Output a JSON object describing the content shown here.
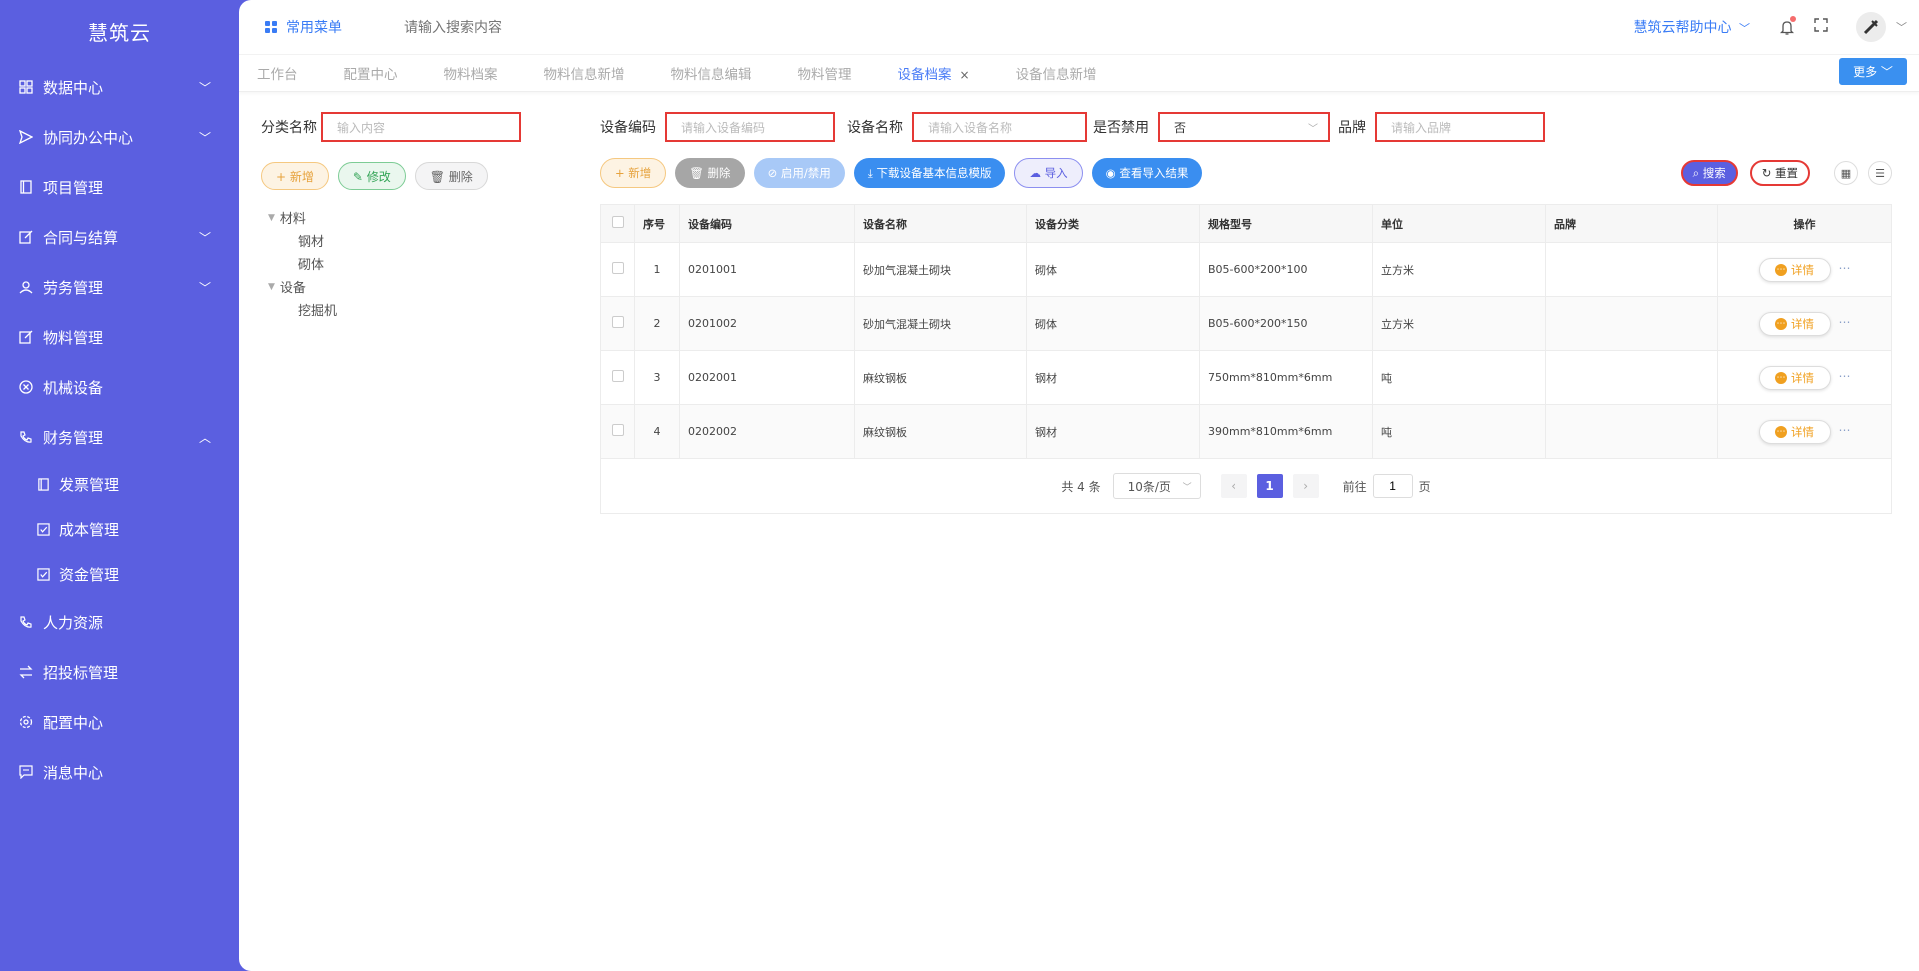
{
  "app_title": "慧筑云",
  "sidebar": {
    "items": [
      {
        "label": "数据中心",
        "icon": "grid-icon",
        "chevron": "﹀"
      },
      {
        "label": "协同办公中心",
        "icon": "send-icon",
        "chevron": "﹀"
      },
      {
        "label": "项目管理",
        "icon": "book-icon",
        "chevron": ""
      },
      {
        "label": "合同与结算",
        "icon": "edit-icon",
        "chevron": "﹀"
      },
      {
        "label": "劳务管理",
        "icon": "user-icon",
        "chevron": "﹀"
      },
      {
        "label": "物料管理",
        "icon": "edit-icon",
        "chevron": ""
      },
      {
        "label": "机械设备",
        "icon": "circle-x-icon",
        "chevron": ""
      },
      {
        "label": "财务管理",
        "icon": "phone-icon",
        "chevron": "︿"
      }
    ],
    "sub_items": [
      {
        "label": "发票管理",
        "icon": "book-icon"
      },
      {
        "label": "成本管理",
        "icon": "checkbox-icon"
      },
      {
        "label": "资金管理",
        "icon": "checkbox-icon"
      }
    ],
    "items_after": [
      {
        "label": "人力资源",
        "icon": "phone-icon"
      },
      {
        "label": "招投标管理",
        "icon": "transfer-icon"
      },
      {
        "label": "配置中心",
        "icon": "gear-icon"
      },
      {
        "label": "消息中心",
        "icon": "message-icon"
      }
    ]
  },
  "topbar": {
    "favorites_label": "常用菜单",
    "search_placeholder": "请输入搜索内容",
    "help_label": "慧筑云帮助中心",
    "help_chevron": "﹀"
  },
  "tabs": [
    {
      "label": "工作台"
    },
    {
      "label": "配置中心"
    },
    {
      "label": "物料档案"
    },
    {
      "label": "物料信息新增"
    },
    {
      "label": "物料信息编辑"
    },
    {
      "label": "物料管理"
    },
    {
      "label": "设备档案",
      "active": true
    },
    {
      "label": "设备信息新增"
    }
  ],
  "more_label": "更多 ﹀",
  "left_panel": {
    "category_label": "分类名称",
    "category_placeholder": "输入内容",
    "buttons": {
      "add": "+ 新增",
      "edit": "✎ 修改",
      "delete": "🗑 删除"
    },
    "tree": [
      {
        "label": "材料",
        "children": [
          "钢材",
          "砌体"
        ]
      },
      {
        "label": "设备",
        "children": [
          "挖掘机"
        ]
      }
    ]
  },
  "filters": {
    "code_label": "设备编码",
    "code_placeholder": "请输入设备编码",
    "name_label": "设备名称",
    "name_placeholder": "请输入设备名称",
    "disabled_label": "是否禁用",
    "disabled_value": "否",
    "brand_label": "品牌",
    "brand_placeholder": "请输入品牌"
  },
  "actions": {
    "add": "+ 新增",
    "delete": "🗑 删除",
    "toggle": "⊘ 启用/禁用",
    "download": "⤓ 下载设备基本信息模版",
    "import": "☁ 导入",
    "view_import": "◉ 查看导入结果",
    "search": "⌕ 搜索",
    "reset": "↻ 重置"
  },
  "table": {
    "headers": [
      "序号",
      "设备编码",
      "设备名称",
      "设备分类",
      "规格型号",
      "单位",
      "品牌",
      "操作"
    ],
    "rows": [
      {
        "index": "1",
        "code": "0201001",
        "name": "砂加气混凝土砌块",
        "category": "砌体",
        "spec": "B05-600*200*100",
        "unit": "立方米",
        "brand": ""
      },
      {
        "index": "2",
        "code": "0201002",
        "name": "砂加气混凝土砌块",
        "category": "砌体",
        "spec": "B05-600*200*150",
        "unit": "立方米",
        "brand": ""
      },
      {
        "index": "3",
        "code": "0202001",
        "name": "麻纹钢板",
        "category": "钢材",
        "spec": "750mm*810mm*6mm",
        "unit": "吨",
        "brand": ""
      },
      {
        "index": "4",
        "code": "0202002",
        "name": "麻纹钢板",
        "category": "钢材",
        "spec": "390mm*810mm*6mm",
        "unit": "吨",
        "brand": ""
      }
    ],
    "detail_label": "详情",
    "detail_icon": "⋯"
  },
  "pagination": {
    "total": "共 4 条",
    "page_size": "10条/页",
    "current": "1",
    "goto_prefix": "前往",
    "goto_value": "1",
    "goto_suffix": "页"
  }
}
